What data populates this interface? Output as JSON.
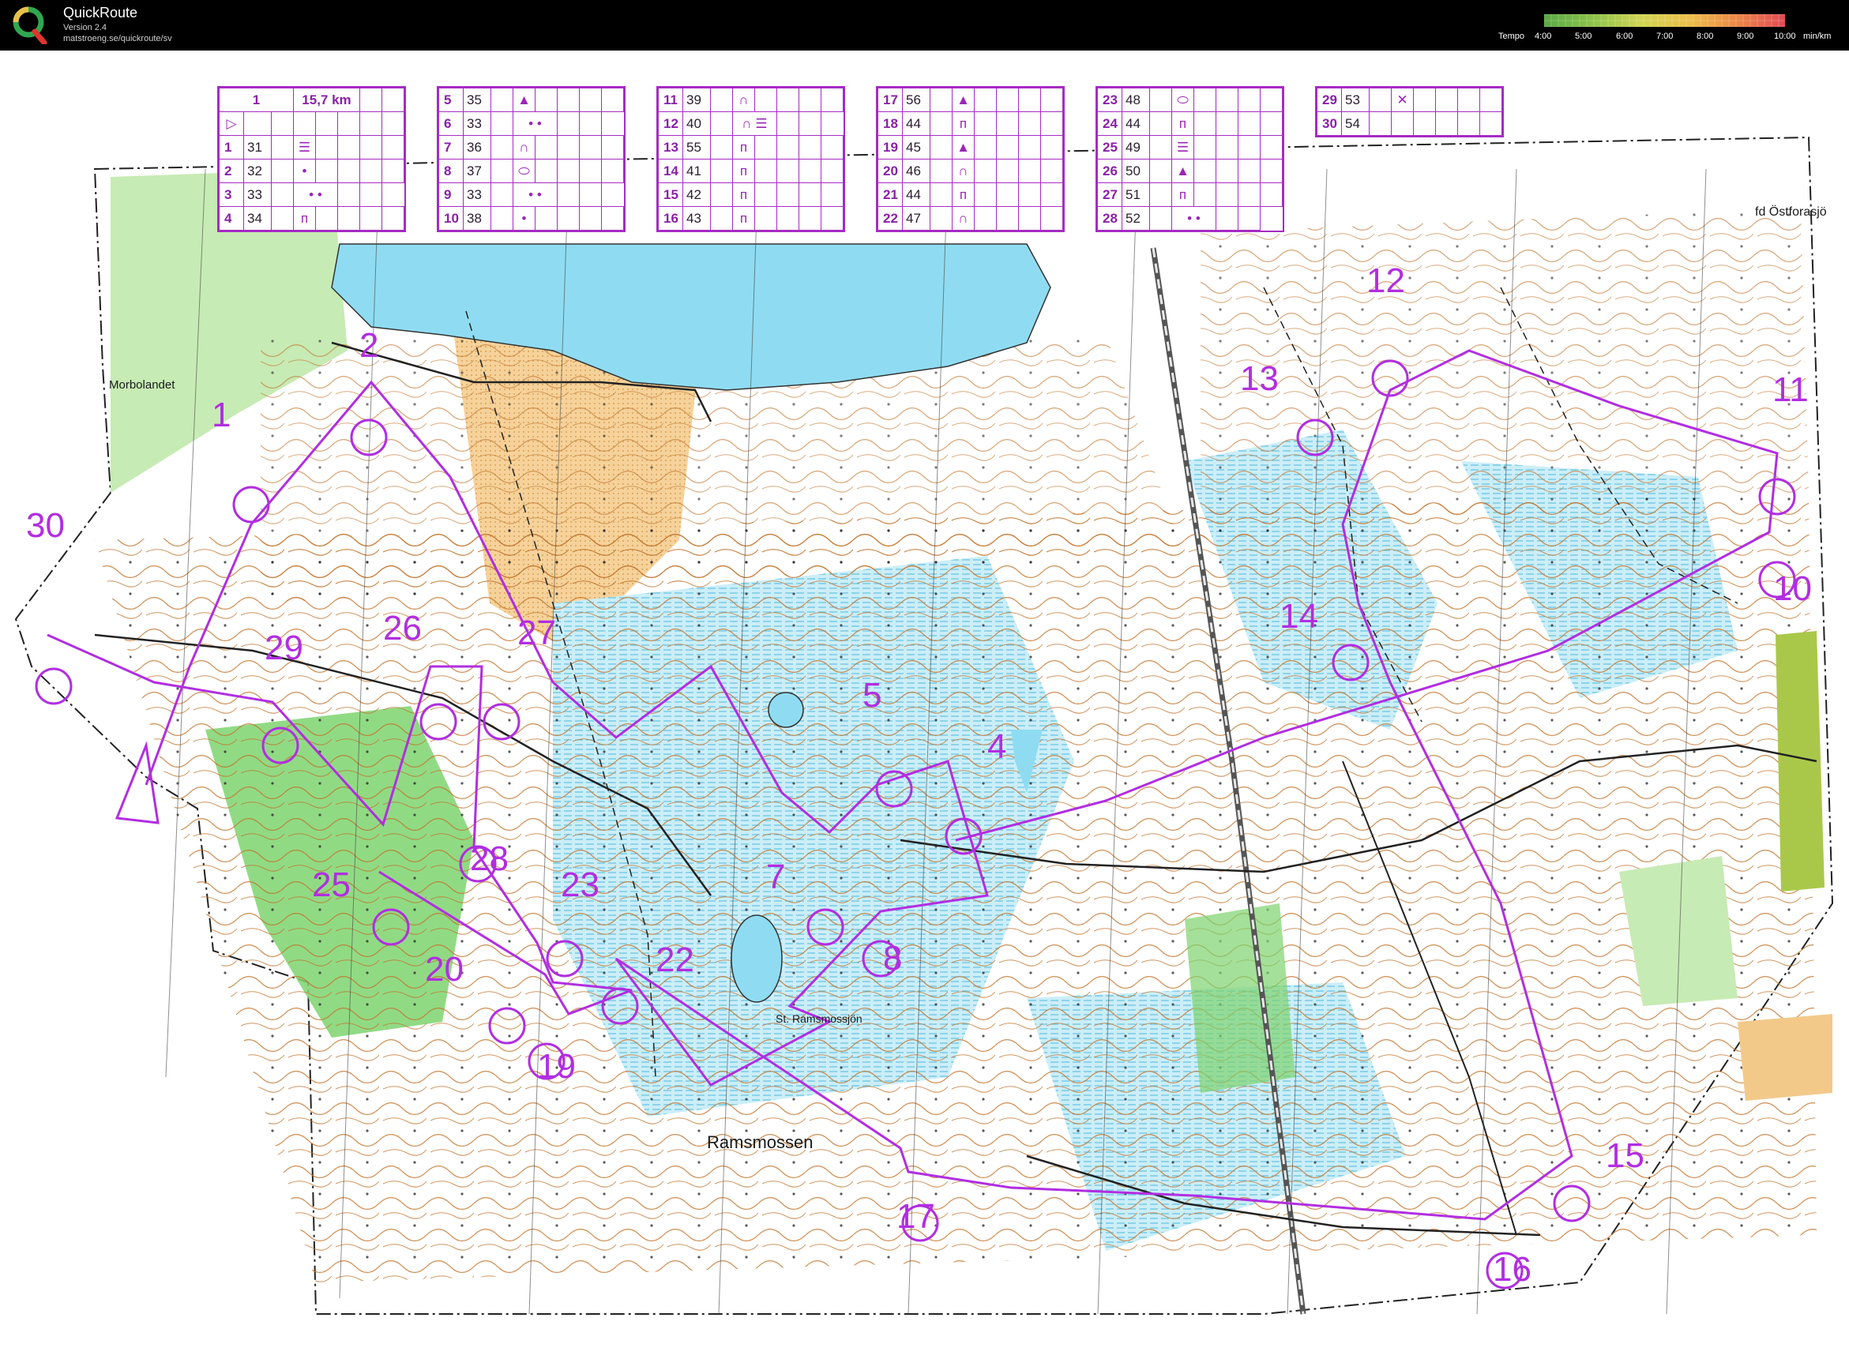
{
  "app": {
    "title": "QuickRoute",
    "version": "Version 2.4",
    "url": "matstroeng.se/quickroute/sv"
  },
  "tempo": {
    "label": "Tempo",
    "ticks": [
      "4:00",
      "5:00",
      "6:00",
      "7:00",
      "8:00",
      "9:00",
      "10:00"
    ],
    "unit": "min/km",
    "colors": [
      "#5aa845",
      "#7dbb48",
      "#a6c94d",
      "#cfd452",
      "#e8c24b",
      "#ee9a45",
      "#ea6b46",
      "#e14a55"
    ]
  },
  "course": {
    "number": "1",
    "length": "15,7 km",
    "start_symbol": "▷"
  },
  "controls": [
    {
      "n": "1",
      "code": "31",
      "sym": "☰"
    },
    {
      "n": "2",
      "code": "32",
      "sym": "•"
    },
    {
      "n": "3",
      "code": "33",
      "sym": "•  •"
    },
    {
      "n": "4",
      "code": "34",
      "sym": "ᴨ"
    },
    {
      "n": "5",
      "code": "35",
      "sym": "▲"
    },
    {
      "n": "6",
      "code": "33",
      "sym": "•  •"
    },
    {
      "n": "7",
      "code": "36",
      "sym": "∩"
    },
    {
      "n": "8",
      "code": "37",
      "sym": "⬭"
    },
    {
      "n": "9",
      "code": "33",
      "sym": "•  •"
    },
    {
      "n": "10",
      "code": "38",
      "sym": "•"
    },
    {
      "n": "11",
      "code": "39",
      "sym": "∩"
    },
    {
      "n": "12",
      "code": "40",
      "sym": "∩ ☰"
    },
    {
      "n": "13",
      "code": "55",
      "sym": "ᴨ"
    },
    {
      "n": "14",
      "code": "41",
      "sym": "ᴨ"
    },
    {
      "n": "15",
      "code": "42",
      "sym": "ᴨ"
    },
    {
      "n": "16",
      "code": "43",
      "sym": "ᴨ"
    },
    {
      "n": "17",
      "code": "56",
      "sym": "▲"
    },
    {
      "n": "18",
      "code": "44",
      "sym": "ᴨ"
    },
    {
      "n": "19",
      "code": "45",
      "sym": "▲"
    },
    {
      "n": "20",
      "code": "46",
      "sym": "∩"
    },
    {
      "n": "21",
      "code": "44",
      "sym": "ᴨ"
    },
    {
      "n": "22",
      "code": "47",
      "sym": "∩"
    },
    {
      "n": "23",
      "code": "48",
      "sym": "⬭"
    },
    {
      "n": "24",
      "code": "44",
      "sym": "ᴨ"
    },
    {
      "n": "25",
      "code": "49",
      "sym": "☰"
    },
    {
      "n": "26",
      "code": "50",
      "sym": "▲"
    },
    {
      "n": "27",
      "code": "51",
      "sym": "ᴨ"
    },
    {
      "n": "28",
      "code": "52",
      "sym": "•  •"
    },
    {
      "n": "29",
      "code": "53",
      "sym": "✕"
    },
    {
      "n": "30",
      "code": "54",
      "sym": ""
    }
  ],
  "map_labels": {
    "morbolandet": "Morbolandet",
    "ostforasjo": "fd Östforasjö",
    "ramsmossjon": "St. Ramsmossjön",
    "ramsmossen": "Ramsmossen"
  },
  "control_numbers": [
    "1",
    "2",
    "4",
    "5",
    "7",
    "8",
    "10",
    "11",
    "12",
    "13",
    "14",
    "15",
    "16",
    "17",
    "19",
    "20",
    "22",
    "23",
    "25",
    "26",
    "27",
    "28",
    "29",
    "30"
  ],
  "colors": {
    "course": "#b12ee0",
    "water": "#8fdcf2",
    "forest_green": "#7ed36e",
    "light_green": "#c7ebb4",
    "open_land": "#f3c98a",
    "marsh_blue": "#c6ecf6",
    "contour": "#b5651d"
  }
}
